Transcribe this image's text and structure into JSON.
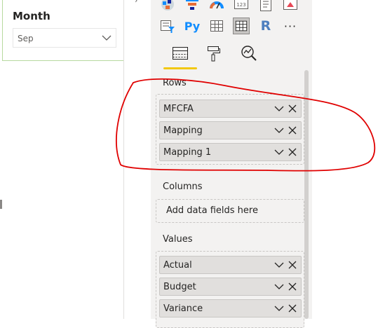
{
  "slicer": {
    "title": "Month",
    "selected": "Sep"
  },
  "visualizations": {
    "icons": [
      "waffle-map-icon",
      "funnel-icon",
      "gauge-icon",
      "card-icon",
      "multi-row-card-icon",
      "kpi-icon",
      "slicer-icon",
      "python-visual-icon",
      "table-icon",
      "matrix-icon",
      "r-visual-icon",
      "more-icon"
    ],
    "python_label": "Py",
    "r_label": "R",
    "card_label": "123",
    "more_label": "···",
    "tabs": [
      "fields-tab-icon",
      "format-tab-icon",
      "analytics-tab-icon"
    ]
  },
  "rows": {
    "label": "Rows",
    "fields": [
      "MFCFA",
      "Mapping",
      "Mapping 1"
    ]
  },
  "columns": {
    "label": "Columns",
    "placeholder": "Add data fields here"
  },
  "values": {
    "label": "Values",
    "fields": [
      "Actual",
      "Budget",
      "Variance"
    ]
  },
  "colors": {
    "accent": "#f2c811",
    "annotation": "#e00000",
    "slicer_border": "#b7d99f",
    "pane_bg": "#f3f2f1"
  }
}
